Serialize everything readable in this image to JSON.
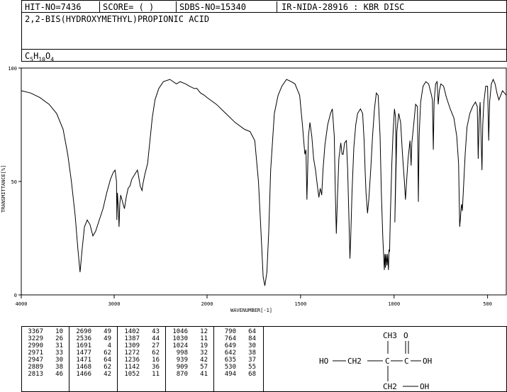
{
  "header": {
    "hit_no": "HIT-NO=7436",
    "score": "SCORE=  (   )",
    "sdbs_no": "SDBS-NO=15340",
    "method": "IR-NIDA-28916 : KBR DISC"
  },
  "compound": {
    "name": "2,2-BIS(HYDROXYMETHYL)PROPIONIC ACID",
    "formula_parts": [
      "C",
      "5",
      "H",
      "10",
      "O",
      "4"
    ]
  },
  "chart_data": {
    "type": "line",
    "title": "",
    "xlabel": "WAVENUMBER[-1]",
    "ylabel": "TRANSMITTANCE[%]",
    "xlim": [
      4000,
      400
    ],
    "ylim": [
      0,
      100
    ],
    "x_ticks": [
      4000,
      3000,
      2000,
      1500,
      1000,
      500
    ],
    "y_ticks": [
      0,
      50,
      100
    ],
    "grid": false,
    "series": [
      {
        "points": [
          [
            4000,
            90
          ],
          [
            3900,
            89
          ],
          [
            3800,
            87
          ],
          [
            3700,
            84
          ],
          [
            3620,
            80
          ],
          [
            3550,
            73
          ],
          [
            3500,
            62
          ],
          [
            3460,
            50
          ],
          [
            3420,
            35
          ],
          [
            3390,
            20
          ],
          [
            3367,
            10
          ],
          [
            3345,
            20
          ],
          [
            3320,
            30
          ],
          [
            3290,
            33
          ],
          [
            3260,
            31
          ],
          [
            3229,
            26
          ],
          [
            3200,
            28
          ],
          [
            3160,
            33
          ],
          [
            3120,
            38
          ],
          [
            3080,
            45
          ],
          [
            3040,
            51
          ],
          [
            3010,
            54
          ],
          [
            2990,
            55
          ],
          [
            2975,
            50
          ],
          [
            2971,
            33
          ],
          [
            2965,
            45
          ],
          [
            2955,
            38
          ],
          [
            2947,
            30
          ],
          [
            2940,
            40
          ],
          [
            2930,
            44
          ],
          [
            2910,
            41
          ],
          [
            2889,
            38
          ],
          [
            2870,
            43
          ],
          [
            2850,
            47
          ],
          [
            2830,
            48
          ],
          [
            2810,
            51
          ],
          [
            2780,
            53
          ],
          [
            2750,
            55
          ],
          [
            2740,
            53
          ],
          [
            2720,
            48
          ],
          [
            2700,
            46
          ],
          [
            2690,
            49
          ],
          [
            2670,
            53
          ],
          [
            2640,
            58
          ],
          [
            2610,
            70
          ],
          [
            2590,
            78
          ],
          [
            2560,
            86
          ],
          [
            2520,
            91
          ],
          [
            2470,
            94
          ],
          [
            2400,
            95
          ],
          [
            2330,
            93
          ],
          [
            2290,
            94
          ],
          [
            2230,
            93
          ],
          [
            2190,
            92
          ],
          [
            2140,
            91
          ],
          [
            2110,
            91
          ],
          [
            2070,
            89
          ],
          [
            2030,
            88
          ],
          [
            2000,
            87
          ],
          [
            1950,
            84
          ],
          [
            1900,
            80
          ],
          [
            1850,
            76
          ],
          [
            1800,
            73
          ],
          [
            1770,
            72
          ],
          [
            1745,
            68
          ],
          [
            1725,
            50
          ],
          [
            1710,
            25
          ],
          [
            1700,
            8
          ],
          [
            1691,
            4
          ],
          [
            1680,
            10
          ],
          [
            1670,
            28
          ],
          [
            1660,
            55
          ],
          [
            1640,
            80
          ],
          [
            1620,
            88
          ],
          [
            1600,
            92
          ],
          [
            1575,
            95
          ],
          [
            1550,
            94
          ],
          [
            1530,
            93
          ],
          [
            1505,
            88
          ],
          [
            1490,
            75
          ],
          [
            1477,
            62
          ],
          [
            1471,
            64
          ],
          [
            1466,
            42
          ],
          [
            1462,
            55
          ],
          [
            1458,
            70
          ],
          [
            1450,
            76
          ],
          [
            1440,
            70
          ],
          [
            1430,
            60
          ],
          [
            1420,
            55
          ],
          [
            1410,
            48
          ],
          [
            1402,
            43
          ],
          [
            1395,
            47
          ],
          [
            1387,
            44
          ],
          [
            1380,
            55
          ],
          [
            1370,
            66
          ],
          [
            1355,
            75
          ],
          [
            1340,
            80
          ],
          [
            1330,
            82
          ],
          [
            1320,
            70
          ],
          [
            1314,
            45
          ],
          [
            1309,
            27
          ],
          [
            1303,
            42
          ],
          [
            1295,
            60
          ],
          [
            1285,
            67
          ],
          [
            1278,
            62
          ],
          [
            1272,
            62
          ],
          [
            1265,
            67
          ],
          [
            1255,
            68
          ],
          [
            1248,
            55
          ],
          [
            1240,
            30
          ],
          [
            1236,
            16
          ],
          [
            1232,
            25
          ],
          [
            1225,
            45
          ],
          [
            1215,
            65
          ],
          [
            1205,
            75
          ],
          [
            1195,
            80
          ],
          [
            1180,
            82
          ],
          [
            1168,
            80
          ],
          [
            1160,
            68
          ],
          [
            1155,
            55
          ],
          [
            1150,
            45
          ],
          [
            1142,
            36
          ],
          [
            1135,
            42
          ],
          [
            1125,
            55
          ],
          [
            1115,
            70
          ],
          [
            1105,
            82
          ],
          [
            1095,
            89
          ],
          [
            1085,
            88
          ],
          [
            1075,
            70
          ],
          [
            1068,
            45
          ],
          [
            1060,
            25
          ],
          [
            1052,
            11
          ],
          [
            1049,
            18
          ],
          [
            1046,
            12
          ],
          [
            1043,
            18
          ],
          [
            1038,
            13
          ],
          [
            1035,
            18
          ],
          [
            1030,
            11
          ],
          [
            1027,
            20
          ],
          [
            1024,
            19
          ],
          [
            1020,
            35
          ],
          [
            1012,
            58
          ],
          [
            1005,
            72
          ],
          [
            998,
            82
          ],
          [
            992,
            78
          ],
          [
            990,
            60
          ],
          [
            996,
            32
          ],
          [
            985,
            72
          ],
          [
            975,
            80
          ],
          [
            965,
            76
          ],
          [
            955,
            62
          ],
          [
            945,
            50
          ],
          [
            939,
            42
          ],
          [
            933,
            50
          ],
          [
            925,
            60
          ],
          [
            915,
            68
          ],
          [
            909,
            57
          ],
          [
            905,
            67
          ],
          [
            895,
            75
          ],
          [
            885,
            84
          ],
          [
            875,
            83
          ],
          [
            870,
            41
          ],
          [
            866,
            70
          ],
          [
            858,
            85
          ],
          [
            845,
            92
          ],
          [
            830,
            94
          ],
          [
            815,
            93
          ],
          [
            800,
            88
          ],
          [
            795,
            86
          ],
          [
            790,
            64
          ],
          [
            786,
            85
          ],
          [
            778,
            93
          ],
          [
            770,
            94
          ],
          [
            764,
            84
          ],
          [
            758,
            90
          ],
          [
            750,
            93
          ],
          [
            735,
            92
          ],
          [
            720,
            87
          ],
          [
            700,
            82
          ],
          [
            680,
            78
          ],
          [
            665,
            70
          ],
          [
            655,
            58
          ],
          [
            649,
            30
          ],
          [
            645,
            34
          ],
          [
            642,
            38
          ],
          [
            639,
            40
          ],
          [
            635,
            37
          ],
          [
            630,
            45
          ],
          [
            620,
            62
          ],
          [
            610,
            74
          ],
          [
            595,
            80
          ],
          [
            580,
            83
          ],
          [
            565,
            85
          ],
          [
            555,
            83
          ],
          [
            550,
            60
          ],
          [
            545,
            78
          ],
          [
            540,
            85
          ],
          [
            530,
            55
          ],
          [
            526,
            75
          ],
          [
            520,
            85
          ],
          [
            510,
            92
          ],
          [
            500,
            92
          ],
          [
            494,
            68
          ],
          [
            489,
            85
          ],
          [
            480,
            93
          ],
          [
            470,
            95
          ],
          [
            460,
            93
          ],
          [
            450,
            89
          ],
          [
            440,
            86
          ],
          [
            430,
            88
          ],
          [
            420,
            90
          ],
          [
            410,
            89
          ],
          [
            400,
            88
          ]
        ]
      }
    ],
    "peak_table": [
      [
        "3367",
        "10"
      ],
      [
        "3229",
        "26"
      ],
      [
        "2990",
        "31"
      ],
      [
        "2971",
        "33"
      ],
      [
        "2947",
        "30"
      ],
      [
        "2889",
        "38"
      ],
      [
        "2813",
        "46"
      ],
      [
        "2690",
        "49"
      ],
      [
        "2536",
        "49"
      ],
      [
        "1691",
        "4"
      ],
      [
        "1477",
        "62"
      ],
      [
        "1471",
        "64"
      ],
      [
        "1468",
        "62"
      ],
      [
        "1466",
        "42"
      ],
      [
        "1402",
        "43"
      ],
      [
        "1387",
        "44"
      ],
      [
        "1309",
        "27"
      ],
      [
        "1272",
        "62"
      ],
      [
        "1236",
        "16"
      ],
      [
        "1142",
        "36"
      ],
      [
        "1052",
        "11"
      ],
      [
        "1046",
        "12"
      ],
      [
        "1030",
        "11"
      ],
      [
        "1024",
        "19"
      ],
      [
        "998",
        "32"
      ],
      [
        "939",
        "42"
      ],
      [
        "909",
        "57"
      ],
      [
        "870",
        "41"
      ],
      [
        "790",
        "64"
      ],
      [
        "764",
        "84"
      ],
      [
        "649",
        "30"
      ],
      [
        "642",
        "38"
      ],
      [
        "635",
        "37"
      ],
      [
        "530",
        "55"
      ],
      [
        "494",
        "68"
      ]
    ]
  },
  "structure": {
    "ch3": "CH3",
    "o": "O",
    "ho": "HO",
    "ch2_left": "CH2",
    "c_center": "C",
    "c_acid": "C",
    "oh_acid": "OH",
    "ch2_bottom": "CH2",
    "oh_bottom": "OH"
  }
}
